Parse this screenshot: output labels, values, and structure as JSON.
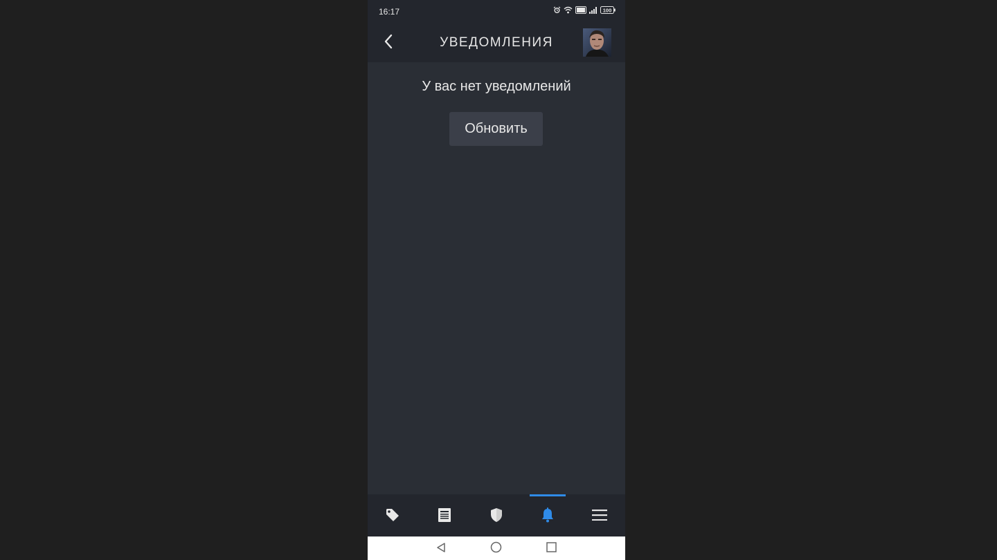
{
  "status_bar": {
    "time": "16:17",
    "icons": [
      "alarm-icon",
      "wifi-icon",
      "volte-icon",
      "signal-icon",
      "battery-icon"
    ],
    "battery_text": "100"
  },
  "header": {
    "back_icon": "chevron-left-icon",
    "title": "УВЕДОМЛЕНИЯ"
  },
  "main": {
    "empty_message": "У вас нет уведомлений",
    "refresh_label": "Обновить"
  },
  "bottom_nav": {
    "items": [
      {
        "icon": "tag-icon",
        "active": false
      },
      {
        "icon": "news-icon",
        "active": false
      },
      {
        "icon": "shield-icon",
        "active": false
      },
      {
        "icon": "bell-icon",
        "active": true
      },
      {
        "icon": "menu-icon",
        "active": false
      }
    ],
    "active_color": "#2f8be8",
    "inactive_color": "#e8e8e8"
  },
  "system_nav": {
    "buttons": [
      "back-triangle-icon",
      "home-circle-icon",
      "recents-square-icon"
    ]
  },
  "colors": {
    "background": "#1f1f1f",
    "app_bg": "#2a2e35",
    "header_bg": "#23262d",
    "button_bg": "#3b3f49",
    "accent": "#2f8be8"
  }
}
